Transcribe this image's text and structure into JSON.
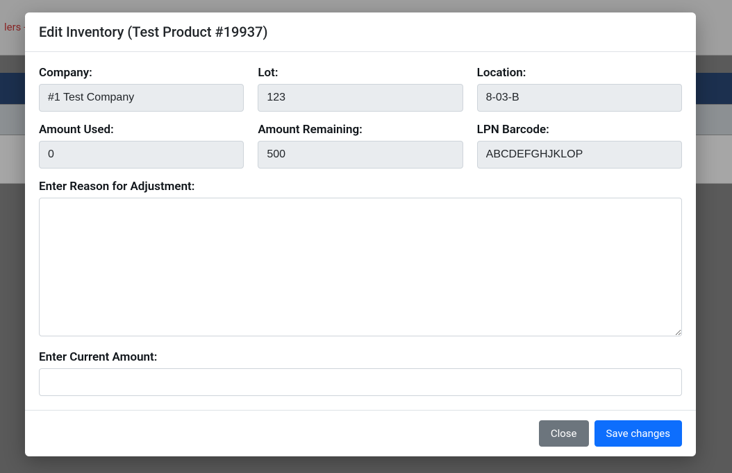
{
  "background": {
    "toplink": "lers -"
  },
  "modal": {
    "title": "Edit Inventory (Test Product #19937)",
    "fields": {
      "company": {
        "label": "Company:",
        "value": "#1 Test Company"
      },
      "lot": {
        "label": "Lot:",
        "value": "123"
      },
      "location": {
        "label": "Location:",
        "value": "8-03-B"
      },
      "amount_used": {
        "label": "Amount Used:",
        "value": "0"
      },
      "amount_remaining": {
        "label": "Amount Remaining:",
        "value": "500"
      },
      "lpn_barcode": {
        "label": "LPN Barcode:",
        "value": "ABCDEFGHJKLOP"
      },
      "reason": {
        "label": "Enter Reason for Adjustment:",
        "value": ""
      },
      "current_amount": {
        "label": "Enter Current Amount:",
        "value": ""
      }
    },
    "buttons": {
      "close": "Close",
      "save": "Save changes"
    }
  }
}
